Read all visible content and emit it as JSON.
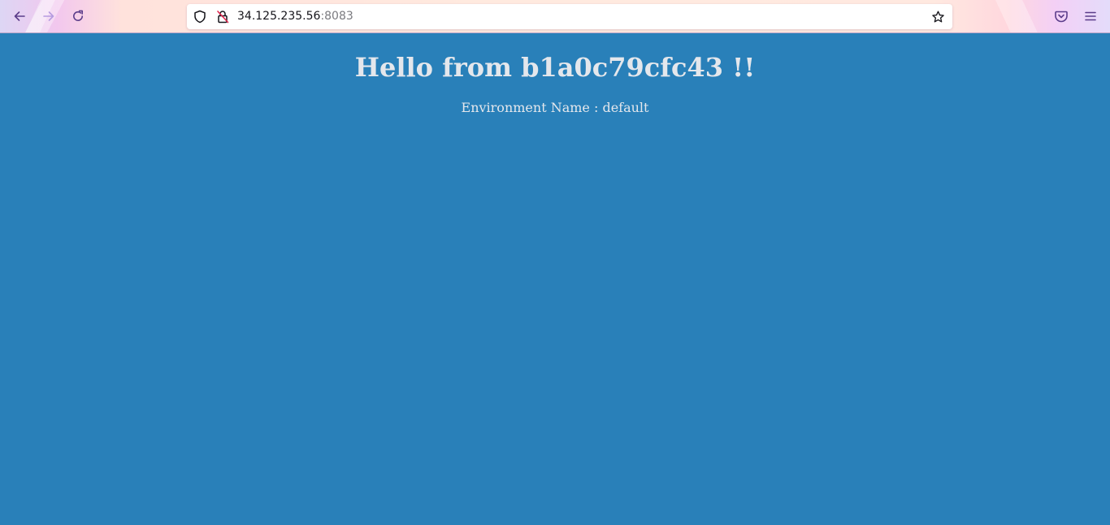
{
  "browser": {
    "url": {
      "host": "34.125.235.56",
      "port": ":8083"
    },
    "icons": {
      "back": "arrow-left-icon",
      "forward": "arrow-right-icon",
      "reload": "reload-icon",
      "tracking_protection": "shield-icon",
      "connection": "insecure-lock-icon",
      "bookmark": "star-icon",
      "pocket": "pocket-icon",
      "menu": "hamburger-menu-icon"
    },
    "colors": {
      "icon": "#5b3d8a",
      "icon_disabled": "#b59be0"
    }
  },
  "page": {
    "title": "Hello from b1a0c79cfc43 !!",
    "environment_line": "Environment Name : default",
    "background_color": "#2980b9",
    "text_color": "#e4e7ec"
  }
}
